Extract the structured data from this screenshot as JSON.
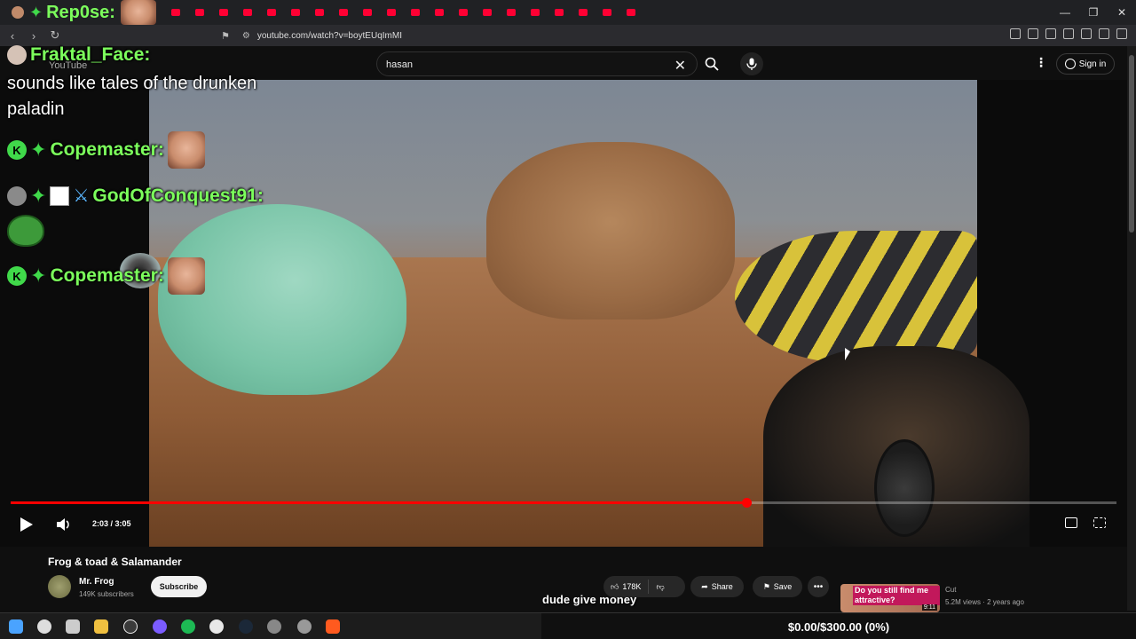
{
  "browser": {
    "url": "youtube.com/watch?v=boytEUqImMI",
    "tab_colors": [
      "#ff0033",
      "#ff0033",
      "#ff0033",
      "#ff0033",
      "#ff0033",
      "#ff0033",
      "#ff0033",
      "#ff0033",
      "#ff0033",
      "#ff0033",
      "#ff0033",
      "#ff0033",
      "#ff0033",
      "#ff0033",
      "#ff0033",
      "#ff0033",
      "#ff0033",
      "#ff0033",
      "#ff0033",
      "#ff0033"
    ]
  },
  "youtube": {
    "logo": "YouTube",
    "search_value": "hasan",
    "sign_in": "Sign in",
    "video": {
      "timecode": "2:03 / 3:05",
      "progress": 0.665,
      "title": "Frog & toad & Salamander",
      "channel": "Mr. Frog",
      "subscribers": "149K subscribers",
      "subscribe": "Subscribe",
      "likes": "178K",
      "share": "Share",
      "save": "Save"
    },
    "recommended": {
      "thumb_text": "Do you still find me attractive?",
      "duration": "9:11",
      "channel": "Cut",
      "meta": "5.2M views · 2 years ago"
    }
  },
  "chat": [
    {
      "user": "Rep0se:"
    },
    {
      "user": "Fraktal_Face:",
      "message": "sounds like tales of the drunken paladin"
    },
    {
      "user": "Copemaster:"
    },
    {
      "user": "GodOfConquest91:"
    },
    {
      "user": "Copemaster:"
    }
  ],
  "overlay": {
    "caption": "dude give money",
    "donation": "$0.00/$300.00 (0%)"
  }
}
